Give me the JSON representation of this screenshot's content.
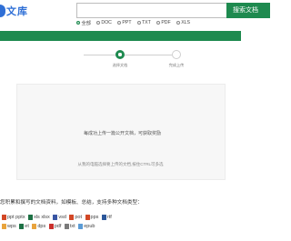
{
  "header": {
    "logo_text": "文库",
    "search_placeholder": "",
    "search_button": "搜索文档"
  },
  "filters": [
    {
      "label": "全部",
      "checked": true
    },
    {
      "label": "DOC",
      "checked": false
    },
    {
      "label": "PPT",
      "checked": false
    },
    {
      "label": "TXT",
      "checked": false
    },
    {
      "label": "PDF",
      "checked": false
    },
    {
      "label": "XLS",
      "checked": false
    }
  ],
  "steps": [
    {
      "label": "选择文档"
    },
    {
      "label": "完成上传"
    }
  ],
  "upload": {
    "button": "每成功上传一篇公开文档，可获取奖励",
    "hint": "从我的电脑选择要上传的文档,按住CTRL可多选"
  },
  "support_text": "您积累和撰写的文档资料，如模板、总结，支持多种文档类型：",
  "file_types_row1": [
    {
      "label": "ppt pptx",
      "icon": "ppt-icon",
      "color": "#d24726"
    },
    {
      "label": "xls xlsx",
      "icon": "xls-icon",
      "color": "#1e7145"
    },
    {
      "label": "vsd",
      "icon": "vsd-icon",
      "color": "#3955a3"
    },
    {
      "label": "pot",
      "icon": "pot-icon",
      "color": "#d24726"
    },
    {
      "label": "pps",
      "icon": "pps-icon",
      "color": "#d24726"
    },
    {
      "label": "rtf",
      "icon": "rtf-icon",
      "color": "#2b579a"
    }
  ],
  "file_types_row2": [
    {
      "label": "wps",
      "icon": "wps-icon",
      "color": "#e8a33d"
    },
    {
      "label": "et",
      "icon": "et-icon",
      "color": "#1e7145"
    },
    {
      "label": "dps",
      "icon": "dps-icon",
      "color": "#e8a33d"
    },
    {
      "label": "pdf",
      "icon": "pdf-icon",
      "color": "#c9302c"
    },
    {
      "label": "txt",
      "icon": "txt-icon",
      "color": "#7a7a7a"
    },
    {
      "label": "epub",
      "icon": "epub-icon",
      "color": "#5b9bd5"
    }
  ]
}
